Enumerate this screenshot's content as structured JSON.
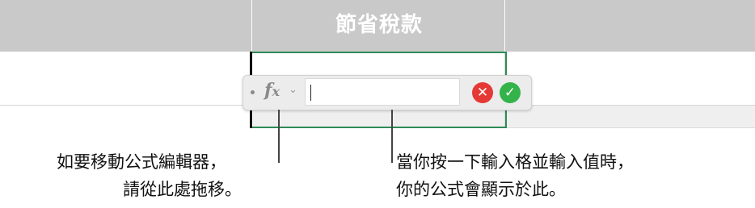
{
  "header": {
    "column_title": "節省稅款"
  },
  "formula_editor": {
    "fx_main": "f",
    "fx_sub": "x",
    "chevron": "⌄",
    "input_value": "",
    "cancel_symbol": "✕",
    "accept_symbol": "✓"
  },
  "captions": {
    "left": {
      "line1": "如要移動公式編輯器，",
      "line2": "請從此處拖移。"
    },
    "right": {
      "line1": "當你按一下輸入格並輸入值時，",
      "line2": "你的公式會顯示於此。"
    }
  },
  "colors": {
    "header_bg": "#c9c9c9",
    "selection": "#2e8b57",
    "cancel": "#e53935",
    "accept": "#34b34a"
  }
}
